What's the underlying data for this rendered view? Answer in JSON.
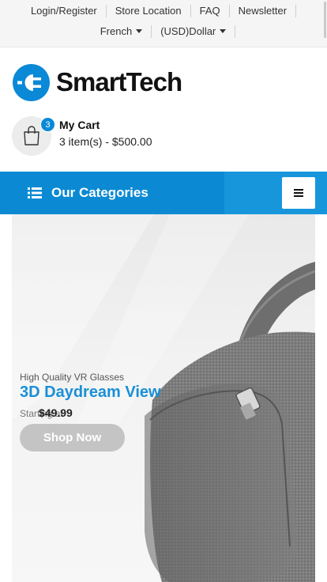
{
  "topbar": {
    "links": [
      "Login/Register",
      "Store Location",
      "FAQ",
      "Newsletter"
    ],
    "language": "French",
    "currency": "(USD)Dollar"
  },
  "logo": {
    "text": "SmartTech",
    "icon": "plug-icon",
    "color": "#0a89d6"
  },
  "cart": {
    "icon": "shopping-bag-icon",
    "count": "3",
    "title": "My Cart",
    "summary": "3 item(s) - $500.00"
  },
  "categories": {
    "label": "Our Categories",
    "icon": "list-icon",
    "menu_icon": "hamburger-icon"
  },
  "banner": {
    "subtitle": "High Quality VR Glasses",
    "title": "3D Daydream View",
    "starting_label": "Starting at",
    "price": "$49.99",
    "cta": "Shop Now",
    "accent": "#1a8fd6"
  }
}
